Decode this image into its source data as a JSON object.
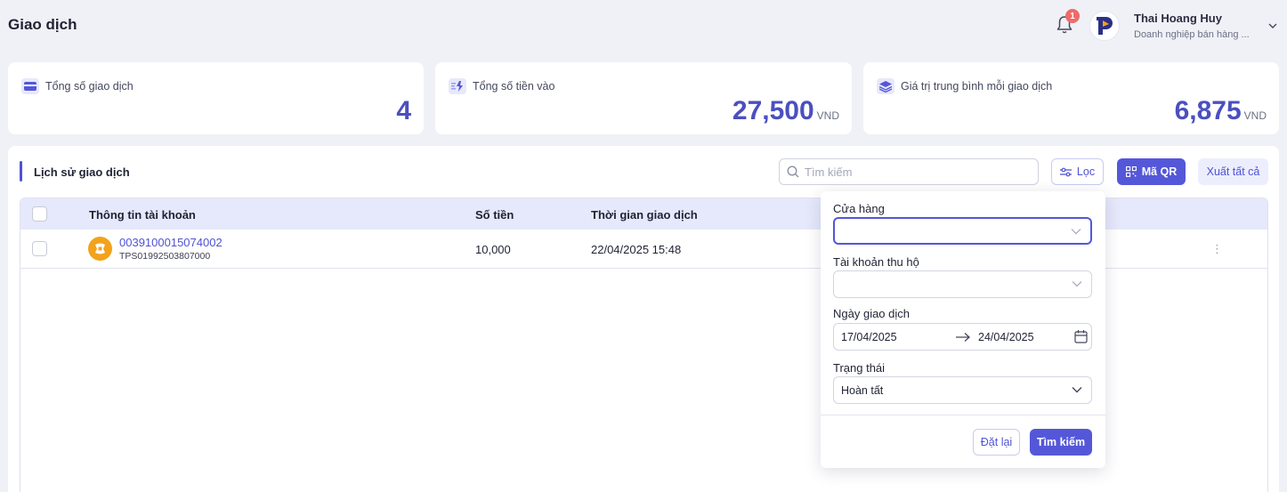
{
  "header": {
    "title": "Giao dịch",
    "notification_count": "1",
    "user_name": "Thai Hoang Huy",
    "user_role": "Doanh nghiệp bán hàng ..."
  },
  "stats": [
    {
      "label": "Tổng số giao dịch",
      "value": "4",
      "unit": ""
    },
    {
      "label": "Tổng số tiền vào",
      "value": "27,500",
      "unit": "VND"
    },
    {
      "label": "Giá trị trung bình mỗi giao dịch",
      "value": "6,875",
      "unit": "VND"
    }
  ],
  "history": {
    "title": "Lịch sử giao dịch",
    "search_placeholder": "Tìm kiếm",
    "filter_label": "Lọc",
    "qr_label": "Mã QR",
    "export_label": "Xuất tất cả",
    "columns": [
      "Thông tin tài khoản",
      "Số tiền",
      "Thời gian giao dịch"
    ],
    "rows": [
      {
        "account_number": "0039100015074002",
        "account_sub": "TPS01992503807000",
        "amount": "10,000",
        "time": "22/04/2025 15:48"
      }
    ]
  },
  "filter_panel": {
    "store_label": "Cửa hàng",
    "store_value": "",
    "collection_account_label": "Tài khoản thu hộ",
    "collection_account_value": "",
    "date_label": "Ngày giao dịch",
    "date_from": "17/04/2025",
    "date_to": "24/04/2025",
    "status_label": "Trạng thái",
    "status_value": "Hoàn tất",
    "reset_label": "Đặt lại",
    "search_label": "Tìm kiếm"
  },
  "colors": {
    "accent": "#5457d8",
    "badge": "#f06a6a",
    "bank_logo": "#f2a21c"
  }
}
